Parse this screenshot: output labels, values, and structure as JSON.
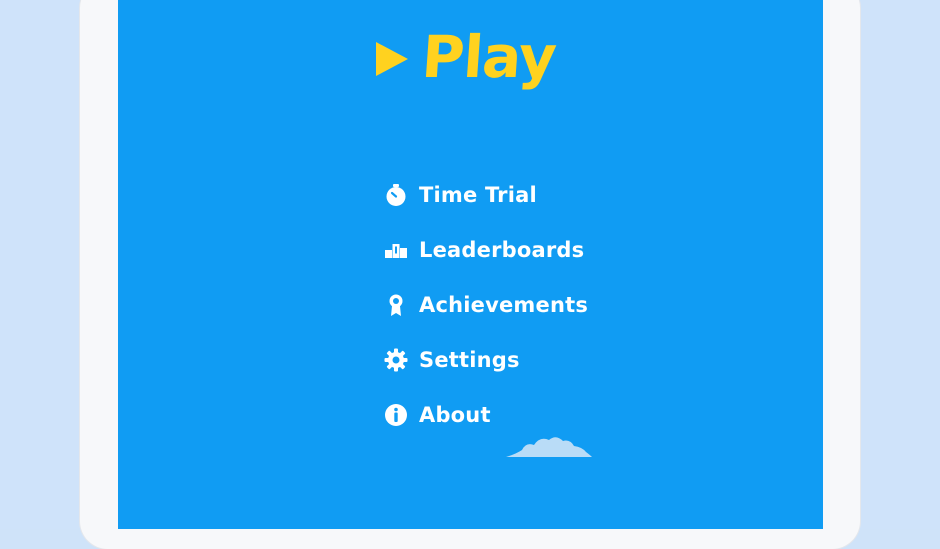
{
  "main_menu": {
    "play": {
      "label": "Play",
      "icon": "play-triangle-icon"
    },
    "items": [
      {
        "label": "Time Trial",
        "icon": "stopwatch-icon"
      },
      {
        "label": "Leaderboards",
        "icon": "podium-icon"
      },
      {
        "label": "Achievements",
        "icon": "ribbon-icon"
      },
      {
        "label": "Settings",
        "icon": "gear-icon"
      },
      {
        "label": "About",
        "icon": "info-icon"
      }
    ]
  },
  "colors": {
    "background": "#109cf3",
    "play_accent": "#ffd21f",
    "menu_text": "#ffffff",
    "cloud": "#b9dcf7",
    "outer_backdrop": "#cfe3fa",
    "device_frame": "#f7f8fa"
  }
}
